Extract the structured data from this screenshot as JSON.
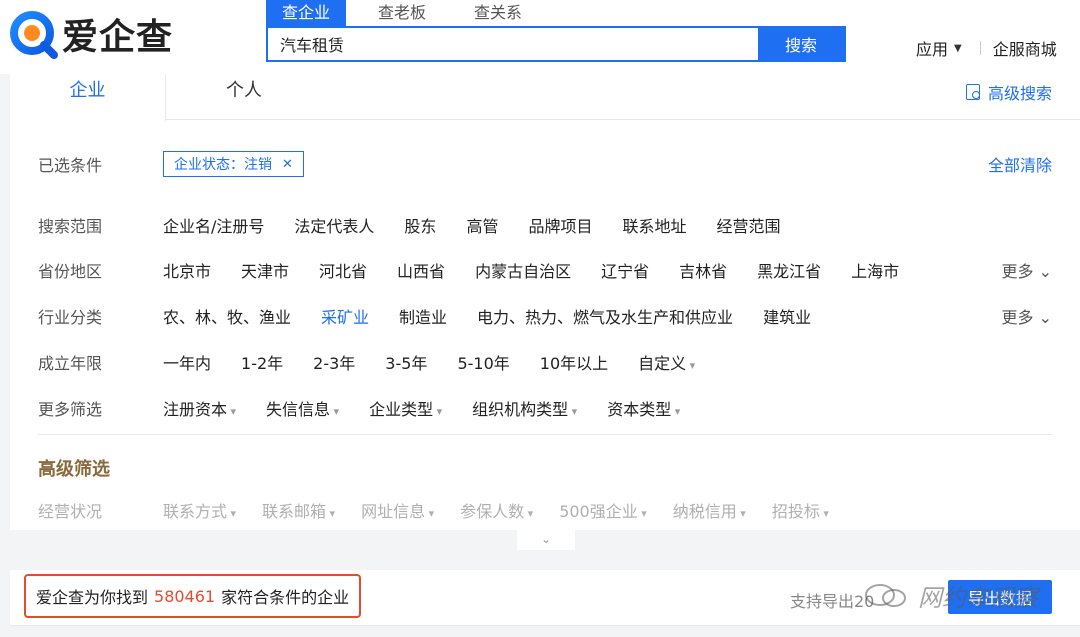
{
  "header": {
    "logo_text": "爱企查",
    "search_tabs": [
      "查企业",
      "查老板",
      "查关系"
    ],
    "search_value": "汽车租赁",
    "search_button": "搜索",
    "apps_label": "应用",
    "mall_label": "企服商城"
  },
  "panel": {
    "type_tabs": [
      "企业",
      "个人"
    ],
    "advanced_search": "高级搜索",
    "selected_label": "已选条件",
    "selected_chip": "企业状态：注销",
    "clear_all": "全部清除",
    "rows": {
      "scope": {
        "label": "搜索范围",
        "options": [
          "企业名/注册号",
          "法定代表人",
          "股东",
          "高管",
          "品牌项目",
          "联系地址",
          "经营范围"
        ]
      },
      "region": {
        "label": "省份地区",
        "options": [
          "北京市",
          "天津市",
          "河北省",
          "山西省",
          "内蒙古自治区",
          "辽宁省",
          "吉林省",
          "黑龙江省",
          "上海市"
        ],
        "more": "更多"
      },
      "industry": {
        "label": "行业分类",
        "options": [
          "农、林、牧、渔业",
          "采矿业",
          "制造业",
          "电力、热力、燃气及水生产和供应业",
          "建筑业"
        ],
        "selected": "采矿业",
        "more": "更多"
      },
      "years": {
        "label": "成立年限",
        "options": [
          "一年内",
          "1-2年",
          "2-3年",
          "3-5年",
          "5-10年",
          "10年以上",
          "自定义"
        ]
      },
      "more_filters": {
        "label": "更多筛选",
        "options": [
          "注册资本",
          "失信信息",
          "企业类型",
          "组织机构类型",
          "资本类型"
        ]
      }
    },
    "advanced": {
      "title": "高级筛选",
      "label": "经营状况",
      "options": [
        "联系方式",
        "联系邮箱",
        "网址信息",
        "参保人数",
        "500强企业",
        "纳税信用",
        "招投标"
      ]
    }
  },
  "result": {
    "prefix": "爱企查为你找到",
    "count": "580461",
    "suffix": "家符合条件的企业",
    "export_note": "支持导出20",
    "export_button": "导出数据"
  },
  "watermark": "网约车观察",
  "colors": {
    "accent": "#1f6ff2",
    "highlight": "#e54c2d",
    "advanced_title": "#8a6a3c"
  }
}
